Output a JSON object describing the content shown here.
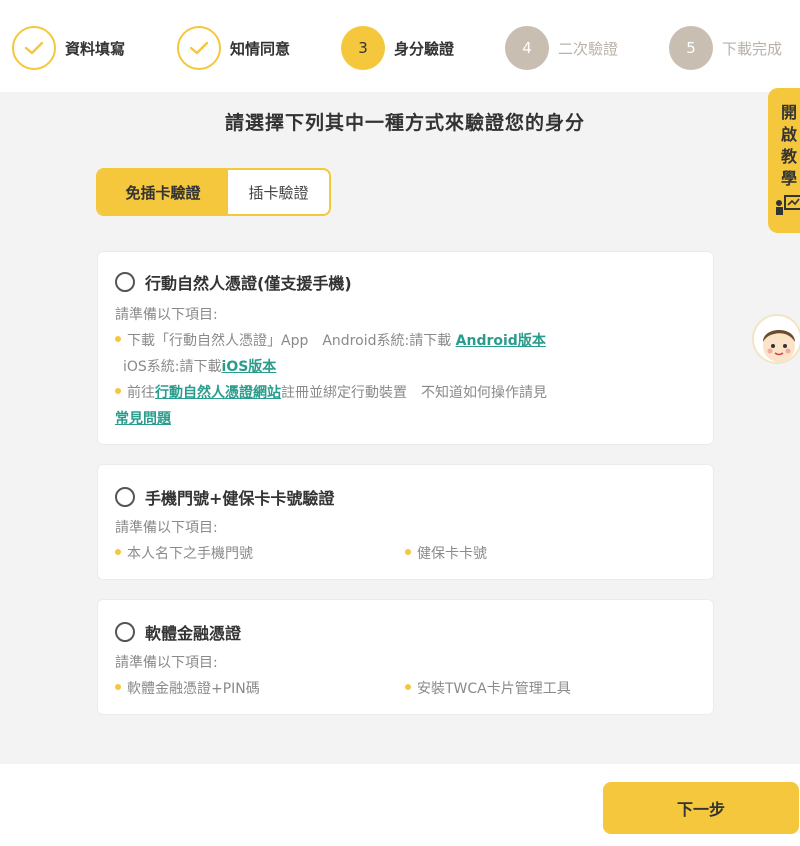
{
  "stepper": {
    "steps": [
      {
        "index": "",
        "label": "資料填寫",
        "state": "done"
      },
      {
        "index": "",
        "label": "知情同意",
        "state": "done"
      },
      {
        "index": "3",
        "label": "身分驗證",
        "state": "current"
      },
      {
        "index": "4",
        "label": "二次驗證",
        "state": "pending"
      },
      {
        "index": "5",
        "label": "下載完成",
        "state": "pending"
      }
    ]
  },
  "main": {
    "title": "請選擇下列其中一種方式來驗證您的身分",
    "toggle": {
      "option_active": "免插卡驗證",
      "option_inactive": "插卡驗證"
    }
  },
  "cards": {
    "mobile_id": {
      "title": "行動自然人憑證(僅支援手機)",
      "prep": "請準備以下項目:",
      "l1_text": "下載「行動自然人憑證」App　Android系統:請下載 ",
      "l1_link": "Android版本",
      "l2_text": "iOS系統:請下載",
      "l2_link": "iOS版本",
      "l3_prefix": "前往",
      "l3_link": "行動自然人憑證網站",
      "l3_text": "註冊並綁定行動裝置　不知道如何操作請見",
      "l4_link": "常見問題"
    },
    "phone_health": {
      "title": "手機門號+健保卡卡號驗證",
      "prep": "請準備以下項目:",
      "item1": "本人名下之手機門號",
      "item2": "健保卡卡號"
    },
    "software_cert": {
      "title": "軟體金融憑證",
      "prep": "請準備以下項目:",
      "item1": "軟體金融憑證+PIN碼",
      "item2": "安裝TWCA卡片管理工具"
    }
  },
  "tutorial": {
    "chars": [
      "開",
      "啟",
      "教",
      "學"
    ]
  },
  "footer": {
    "next_label": "下一步"
  },
  "colors": {
    "accent": "#f5c73c",
    "link": "#2a9c8c",
    "pending": "#c8bfb2"
  }
}
